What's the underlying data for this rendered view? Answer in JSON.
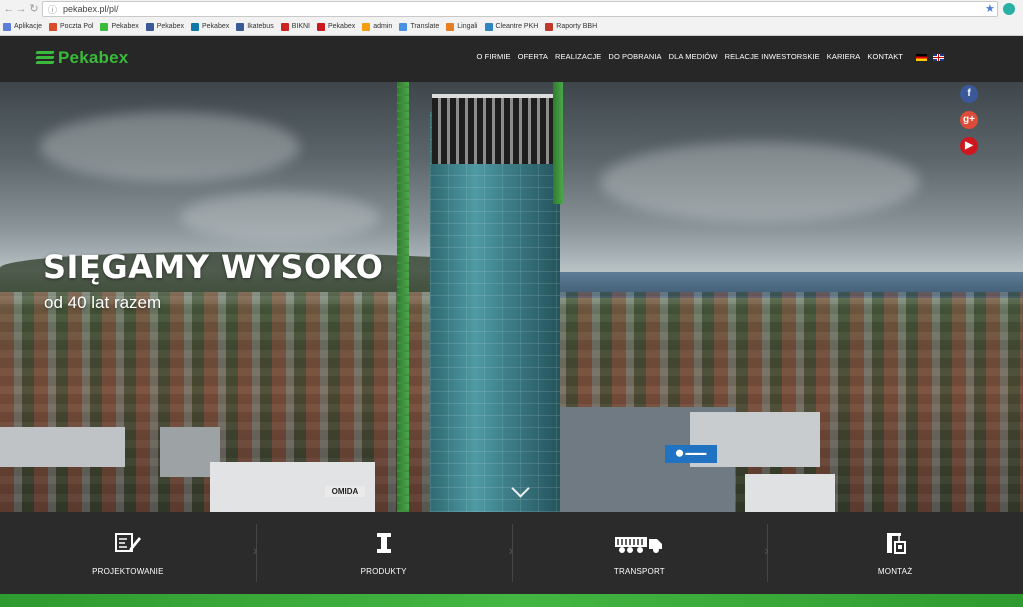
{
  "browser": {
    "address": "pekabex.pl/pl/",
    "bookmarks": [
      {
        "label": "Aplikacje",
        "color": "#5b7fd6"
      },
      {
        "label": "Poczta Pol",
        "color": "#d94a2b"
      },
      {
        "label": "Pekabex",
        "color": "#3aba3a"
      },
      {
        "label": "Pekabex",
        "color": "#3b5998"
      },
      {
        "label": "Pekabex",
        "color": "#0e76a8"
      },
      {
        "label": "Ikatebus",
        "color": "#3b5998"
      },
      {
        "label": "BIKNI",
        "color": "#c22"
      },
      {
        "label": "Pekabex",
        "color": "#cc181e"
      },
      {
        "label": "admin",
        "color": "#f39c12"
      },
      {
        "label": "Translate",
        "color": "#4a90e2"
      },
      {
        "label": "Lingali",
        "color": "#e67e22"
      },
      {
        "label": "Cleantre PKH",
        "color": "#2e86c1"
      },
      {
        "label": "Raporty BBH",
        "color": "#c0392b"
      }
    ]
  },
  "header": {
    "logo": "Pekabex",
    "menu": [
      "O FIRMIE",
      "OFERTA",
      "REALIZACJE",
      "DO POBRANIA",
      "DLA MEDIÓW",
      "RELACJE INWESTORSKIE",
      "KARIERA",
      "KONTAKT"
    ],
    "languages": [
      "de",
      "en"
    ]
  },
  "hero": {
    "title": "SIĘGAMY WYSOKO",
    "subtitle": "od 40 lat razem",
    "sign_text": "OMIDA"
  },
  "social": {
    "facebook": "f",
    "google": "g+",
    "youtube": "▶"
  },
  "services": [
    {
      "label": "PROJEKTOWANIE",
      "icon": "design-icon"
    },
    {
      "label": "PRODUKTY",
      "icon": "beam-icon"
    },
    {
      "label": "TRANSPORT",
      "icon": "truck-icon"
    },
    {
      "label": "MONTAŻ",
      "icon": "crane-icon"
    }
  ],
  "colors": {
    "brand": "#3aba3a",
    "header_bg": "#282828",
    "services_bg": "#2b2b2b"
  }
}
